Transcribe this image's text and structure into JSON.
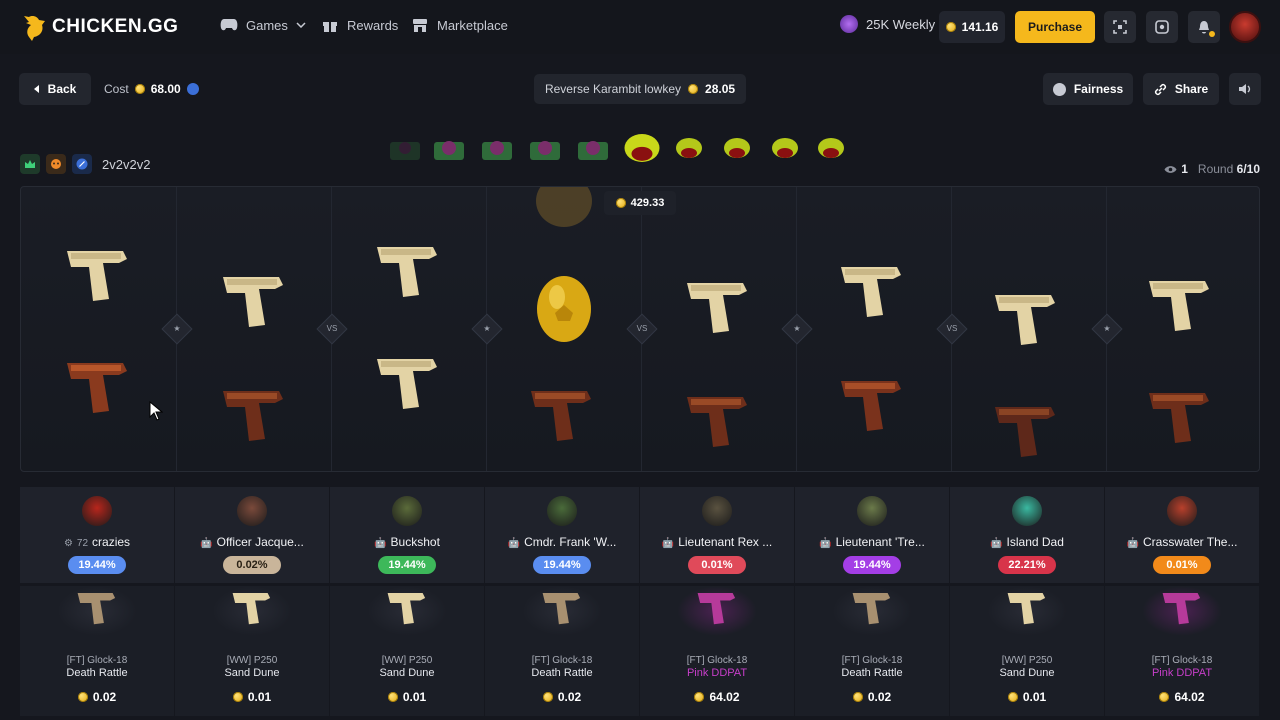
{
  "header": {
    "logo_text": "CHICKEN.GG",
    "nav": [
      {
        "label": "Games",
        "icon": "gamepad-icon"
      },
      {
        "label": "Rewards",
        "icon": "gift-icon"
      },
      {
        "label": "Marketplace",
        "icon": "store-icon"
      }
    ],
    "weekly_label": "25K Weekly",
    "balance": "141.16",
    "purchase_label": "Purchase"
  },
  "toolbar": {
    "back_label": "Back",
    "cost_label": "Cost",
    "cost_value": "68.00",
    "top_drop_name": "Reverse Karambit lowkey",
    "top_drop_value": "28.05",
    "fairness_label": "Fairness",
    "share_label": "Share"
  },
  "battle": {
    "mode_label": "2v2v2v2",
    "spectators": "1",
    "round_label": "Round",
    "round_value": "6/10",
    "float_price": "429.33",
    "vs_label": "VS"
  },
  "players": [
    {
      "name": "crazies",
      "level": "72",
      "pct": "19.44%",
      "pct_bg": "#5a8df0",
      "avatar": "#b8261c"
    },
    {
      "name": "Officer Jacque...",
      "pct": "0.02%",
      "pct_bg": "#c9b59a",
      "avatar": "#7b4a3b"
    },
    {
      "name": "Buckshot",
      "pct": "19.44%",
      "pct_bg": "#3db85a",
      "avatar": "#5b6b3a"
    },
    {
      "name": "Cmdr. Frank 'W...",
      "pct": "19.44%",
      "pct_bg": "#5a8df0",
      "avatar": "#4a6b3a"
    },
    {
      "name": "Lieutenant Rex ...",
      "pct": "0.01%",
      "pct_bg": "#e04a5a",
      "avatar": "#5a5240"
    },
    {
      "name": "Lieutenant 'Tre...",
      "pct": "19.44%",
      "pct_bg": "#a43ee6",
      "avatar": "#6b7a4a"
    },
    {
      "name": "Island Dad",
      "pct": "22.21%",
      "pct_bg": "#d8344a",
      "avatar": "#3ab8a0"
    },
    {
      "name": "Crasswater The...",
      "pct": "0.01%",
      "pct_bg": "#f28a1a",
      "avatar": "#b8402c"
    }
  ],
  "items": [
    {
      "name": "[FT] Glock-18",
      "skin": "Death Rattle",
      "price": "0.02",
      "rarity": "normal"
    },
    {
      "name": "[WW] P250",
      "skin": "Sand Dune",
      "price": "0.01",
      "rarity": "normal"
    },
    {
      "name": "[WW] P250",
      "skin": "Sand Dune",
      "price": "0.01",
      "rarity": "normal"
    },
    {
      "name": "[FT] Glock-18",
      "skin": "Death Rattle",
      "price": "0.02",
      "rarity": "normal"
    },
    {
      "name": "[FT] Glock-18",
      "skin": "Pink DDPAT",
      "price": "64.02",
      "rarity": "pink"
    },
    {
      "name": "[FT] Glock-18",
      "skin": "Death Rattle",
      "price": "0.02",
      "rarity": "normal"
    },
    {
      "name": "[WW] P250",
      "skin": "Sand Dune",
      "price": "0.01",
      "rarity": "normal"
    },
    {
      "name": "[FT] Glock-18",
      "skin": "Pink DDPAT",
      "price": "64.02",
      "rarity": "pink"
    }
  ],
  "colors": {
    "accent": "#f5b81c",
    "pink_rarity": "#c73ec9",
    "background": "#15171e"
  }
}
